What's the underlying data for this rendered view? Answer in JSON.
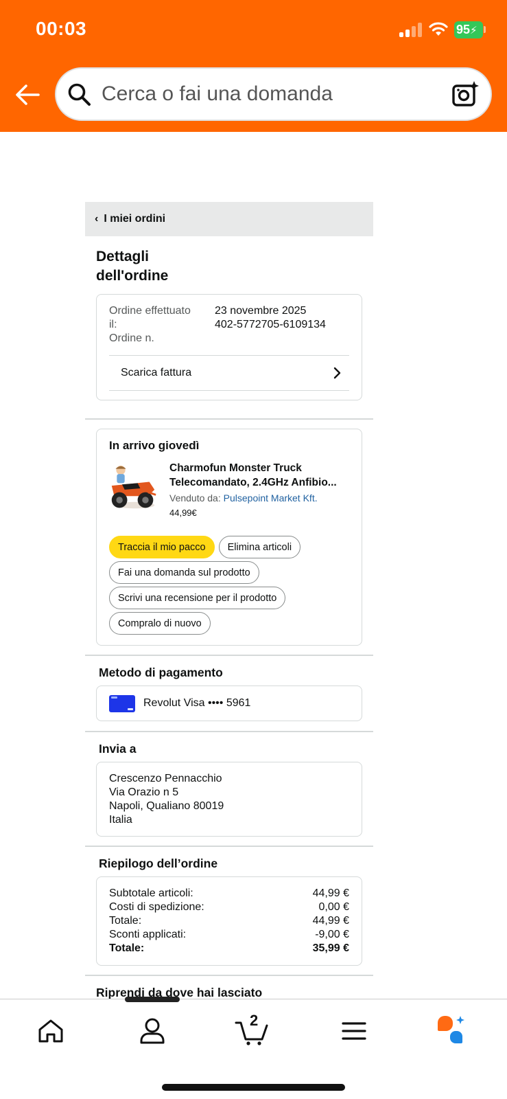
{
  "status_bar": {
    "time": "00:03",
    "battery": "95"
  },
  "search": {
    "placeholder": "Cerca o fai una domanda"
  },
  "breadcrumb": {
    "label": "I miei ordini"
  },
  "page": {
    "title_line1": "Dettagli",
    "title_line2": "dell'ordine"
  },
  "order_info": {
    "placed_label_line1": "Ordine effettuato",
    "placed_label_line2": "il:",
    "order_no_label": "Ordine n.",
    "placed_value": "23 novembre 2025",
    "order_no_value": "402-5772705-6109134",
    "invoice_label": "Scarica fattura"
  },
  "shipment": {
    "title": "In arrivo giovedì",
    "product_name_line1": "Charmofun Monster Truck",
    "product_name_line2": "Telecomandato, 2.4GHz Anfibio...",
    "seller_prefix": "Venduto da:",
    "seller_name": "Pulsepoint Market Kft.",
    "price": "44,99€",
    "actions": {
      "track": "Traccia il mio pacco",
      "delete": "Elimina articoli",
      "ask": "Fai una domanda sul prodotto",
      "review": "Scrivi una recensione per il prodotto",
      "buy_again": "Compralo di nuovo"
    }
  },
  "payment": {
    "title": "Metodo di pagamento",
    "method": "Revolut Visa •••• 5961"
  },
  "shipping": {
    "title": "Invia a",
    "name": "Crescenzo Pennacchio",
    "street": "Via Orazio n 5",
    "city": "Napoli, Qualiano 80019",
    "country": "Italia"
  },
  "summary": {
    "title": "Riepilogo dell’ordine",
    "rows": [
      {
        "label": "Subtotale articoli:",
        "value": "44,99 €"
      },
      {
        "label": "Costi di spedizione:",
        "value": "0,00 €"
      },
      {
        "label": "Totale:",
        "value": "44,99 €"
      },
      {
        "label": "Sconti applicati:",
        "value": "-9,00 €"
      },
      {
        "label": "Totale:",
        "value": "35,99 €"
      }
    ]
  },
  "resume": {
    "title": "Riprendi da dove hai lasciato"
  },
  "nav": {
    "cart_count": "2"
  },
  "colors": {
    "header": "#ff6600",
    "primary_button": "#ffd814",
    "link": "#2162a1",
    "card": "#1d35e8"
  },
  "icons": [
    "back-arrow-icon",
    "search-icon",
    "camera-sparkle-icon",
    "home-icon",
    "account-icon",
    "cart-icon",
    "menu-icon",
    "rufus-assistant-icon"
  ]
}
